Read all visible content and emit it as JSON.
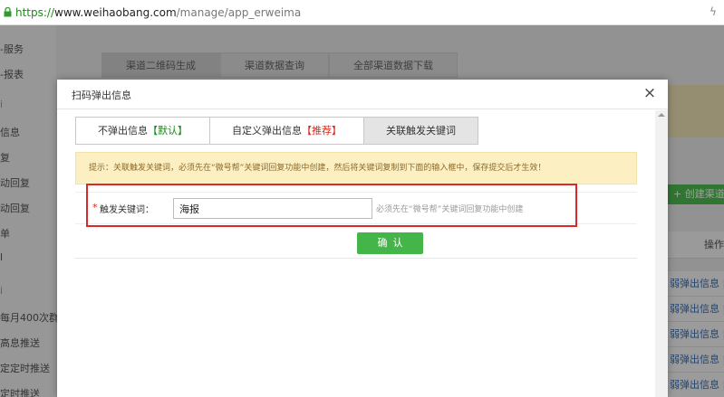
{
  "browser": {
    "url_protocol": "https://",
    "url_domain": "www.weihaobang.com",
    "url_path": "/manage/app_erweima"
  },
  "background": {
    "sidebar_items": [
      "-服务",
      "-报表",
      "i",
      "信息",
      "复",
      "动回复",
      "动回复",
      "单",
      "l",
      "i",
      "每月400次群发",
      "高息推送",
      "定定时推送",
      "定时推送"
    ],
    "tabs": [
      "渠道二维码生成",
      "渠道数据查询",
      "全部渠道数据下载"
    ],
    "create_button": "+ 创建渠道",
    "column_header": "操作",
    "row_link": "弱弹出信息 | 编"
  },
  "modal": {
    "title": "扫码弹出信息",
    "close_glyph": "×",
    "tabs": [
      {
        "label": "不弹出信息",
        "tag": "【默认】",
        "tag_color": "#1a8a1a"
      },
      {
        "label": "自定义弹出信息",
        "tag": "【推荐】",
        "tag_color": "#d6271d"
      },
      {
        "label": "关联触发关键词",
        "tag": "",
        "tag_color": ""
      }
    ],
    "active_tab": 2,
    "tip": "提示：关联触发关键词，必须先在“微号帮”关键词回复功能中创建，然后将关键词复制到下面的输入框中，保存提交后才生效！",
    "required_mark": "*",
    "field_label": "触发关键词：",
    "field_value": "海报",
    "field_hint": "必须先在“微号帮”关键词回复功能中创建",
    "confirm_label": "确认"
  },
  "colors": {
    "accent_green": "#44b549",
    "highlight_red": "#d82a2a",
    "tip_background": "#fcefc2"
  }
}
